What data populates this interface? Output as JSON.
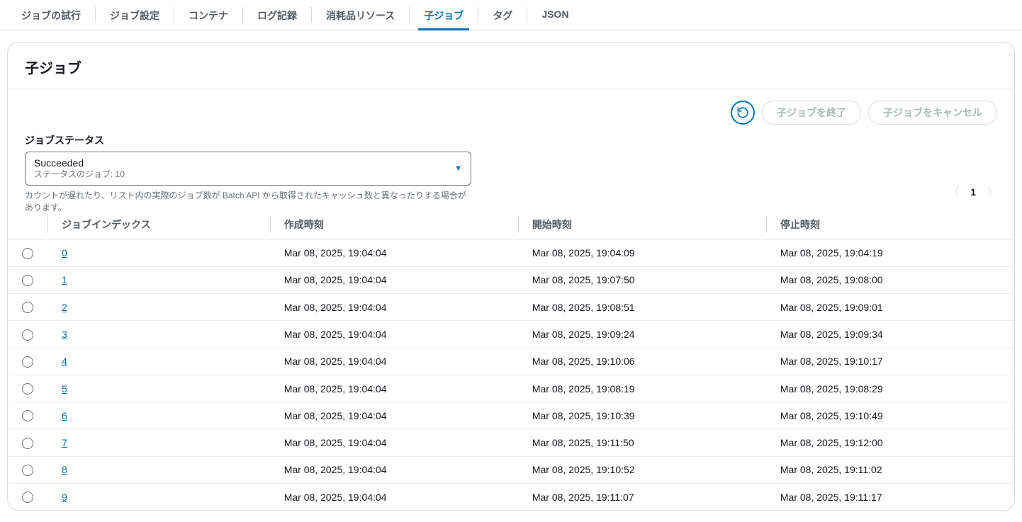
{
  "tabs": [
    {
      "label": "ジョブの試行",
      "active": false
    },
    {
      "label": "ジョブ設定",
      "active": false
    },
    {
      "label": "コンテナ",
      "active": false
    },
    {
      "label": "ログ記録",
      "active": false
    },
    {
      "label": "消耗品リソース",
      "active": false
    },
    {
      "label": "子ジョブ",
      "active": true
    },
    {
      "label": "タグ",
      "active": false
    },
    {
      "label": "JSON",
      "active": false
    }
  ],
  "panel": {
    "title": "子ジョブ",
    "actions": {
      "refresh_icon": "refresh",
      "terminate_label": "子ジョブを終了",
      "cancel_label": "子ジョブをキャンセル"
    },
    "filter": {
      "label": "ジョブステータス",
      "selected_main": "Succeeded",
      "selected_sub": "ステータスのジョブ: 10",
      "hint": "カウントが遅れたり、リスト内の実際のジョブ数が Batch API から取得されたキャッシュ数と異なったりする場合があります。"
    },
    "pager": {
      "current": "1"
    },
    "columns": {
      "index": "ジョブインデックス",
      "created": "作成時刻",
      "started": "開始時刻",
      "stopped": "停止時刻"
    },
    "rows": [
      {
        "index": "0",
        "created": "Mar 08, 2025, 19:04:04",
        "started": "Mar 08, 2025, 19:04:09",
        "stopped": "Mar 08, 2025, 19:04:19"
      },
      {
        "index": "1",
        "created": "Mar 08, 2025, 19:04:04",
        "started": "Mar 08, 2025, 19:07:50",
        "stopped": "Mar 08, 2025, 19:08:00"
      },
      {
        "index": "2",
        "created": "Mar 08, 2025, 19:04:04",
        "started": "Mar 08, 2025, 19:08:51",
        "stopped": "Mar 08, 2025, 19:09:01"
      },
      {
        "index": "3",
        "created": "Mar 08, 2025, 19:04:04",
        "started": "Mar 08, 2025, 19:09:24",
        "stopped": "Mar 08, 2025, 19:09:34"
      },
      {
        "index": "4",
        "created": "Mar 08, 2025, 19:04:04",
        "started": "Mar 08, 2025, 19:10:06",
        "stopped": "Mar 08, 2025, 19:10:17"
      },
      {
        "index": "5",
        "created": "Mar 08, 2025, 19:04:04",
        "started": "Mar 08, 2025, 19:08:19",
        "stopped": "Mar 08, 2025, 19:08:29"
      },
      {
        "index": "6",
        "created": "Mar 08, 2025, 19:04:04",
        "started": "Mar 08, 2025, 19:10:39",
        "stopped": "Mar 08, 2025, 19:10:49"
      },
      {
        "index": "7",
        "created": "Mar 08, 2025, 19:04:04",
        "started": "Mar 08, 2025, 19:11:50",
        "stopped": "Mar 08, 2025, 19:12:00"
      },
      {
        "index": "8",
        "created": "Mar 08, 2025, 19:04:04",
        "started": "Mar 08, 2025, 19:10:52",
        "stopped": "Mar 08, 2025, 19:11:02"
      },
      {
        "index": "9",
        "created": "Mar 08, 2025, 19:04:04",
        "started": "Mar 08, 2025, 19:11:07",
        "stopped": "Mar 08, 2025, 19:11:17"
      }
    ]
  }
}
